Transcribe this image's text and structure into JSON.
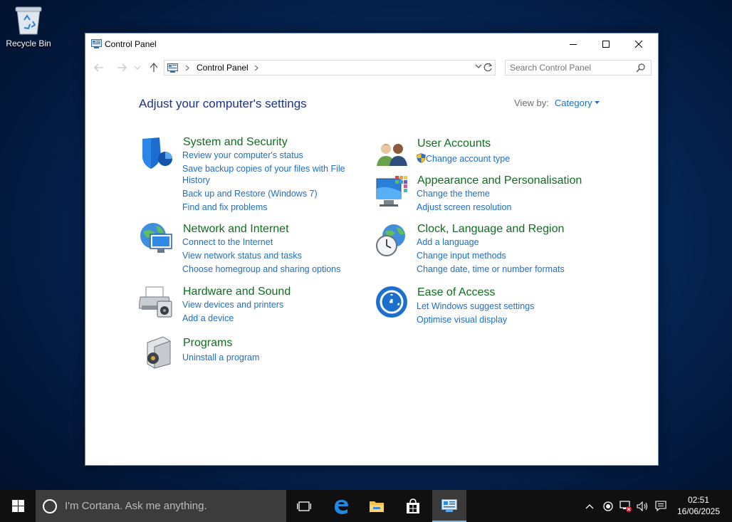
{
  "desktop": {
    "recycle_bin_label": "Recycle Bin"
  },
  "window": {
    "title": "Control Panel",
    "breadcrumb": "Control Panel",
    "search_placeholder": "Search Control Panel",
    "heading": "Adjust your computer's settings",
    "view_by_label": "View by:",
    "view_by_value": "Category"
  },
  "categories": {
    "system_security": {
      "title": "System and Security",
      "links": [
        "Review your computer's status",
        "Save backup copies of your files with File",
        "History",
        "Back up and Restore (Windows 7)",
        "Find and fix problems"
      ]
    },
    "network": {
      "title": "Network and Internet",
      "links": [
        "Connect to the Internet",
        "View network status and tasks",
        "Choose homegroup and sharing options"
      ]
    },
    "hardware": {
      "title": "Hardware and Sound",
      "links": [
        "View devices and printers",
        "Add a device"
      ]
    },
    "programs": {
      "title": "Programs",
      "links": [
        "Uninstall a program"
      ]
    },
    "user_accounts": {
      "title": "User Accounts",
      "links": [
        "Change account type"
      ]
    },
    "appearance": {
      "title": "Appearance and Personalisation",
      "links": [
        "Change the theme",
        "Adjust screen resolution"
      ]
    },
    "clock": {
      "title": "Clock, Language and Region",
      "links": [
        "Add a language",
        "Change input methods",
        "Change date, time or number formats"
      ]
    },
    "ease": {
      "title": "Ease of Access",
      "links": [
        "Let Windows suggest settings",
        "Optimise visual display"
      ]
    }
  },
  "taskbar": {
    "cortana_text": "I'm Cortana. Ask me anything.",
    "time": "02:51",
    "date": "16/06/2025"
  },
  "colors": {
    "heading": "#1e3287",
    "category_title": "#0e6e1e",
    "link": "#1e6fc3",
    "taskbar": "#101010"
  }
}
